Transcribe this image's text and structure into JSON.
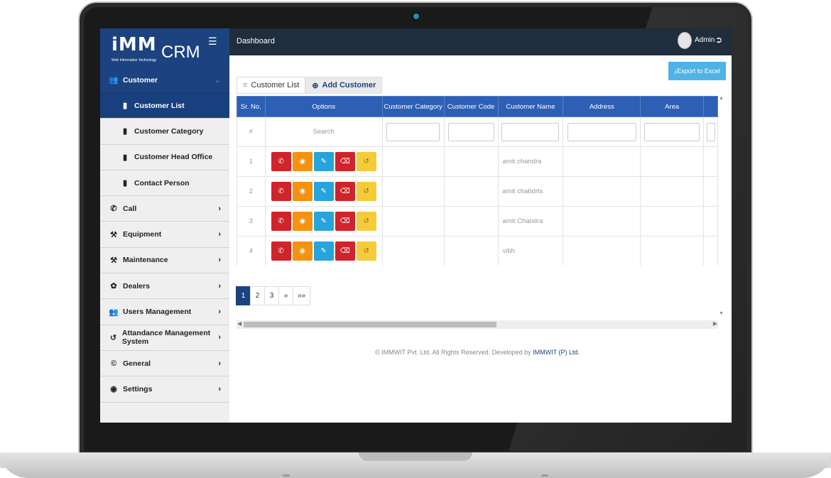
{
  "topbar": {
    "title": "Dashboard",
    "user": "Admin"
  },
  "brand": {
    "logo": "iMM",
    "logo_sub": "Web Information Technology",
    "app": "CRM"
  },
  "sidebar": {
    "items": [
      {
        "label": "Customer",
        "icon": "users-icon"
      },
      {
        "label": "Customer List",
        "icon": "doc-icon"
      },
      {
        "label": "Customer Category",
        "icon": "doc-icon"
      },
      {
        "label": "Customer Head Office",
        "icon": "doc-icon"
      },
      {
        "label": "Contact Person",
        "icon": "doc-icon"
      },
      {
        "label": "Call",
        "icon": "phone-icon"
      },
      {
        "label": "Equipment",
        "icon": "tools-icon"
      },
      {
        "label": "Maintenance",
        "icon": "tools-icon"
      },
      {
        "label": "Dealers",
        "icon": "leaf-icon"
      },
      {
        "label": "Users Management",
        "icon": "users-icon"
      },
      {
        "label": "Attandance Management System",
        "icon": "history-icon"
      },
      {
        "label": "General",
        "icon": "copyright-icon"
      },
      {
        "label": "Settings",
        "icon": "lifebuoy-icon"
      }
    ]
  },
  "actions": {
    "export": "Export to Excel"
  },
  "tabs": {
    "list": "Customer List",
    "add": "Add Customer"
  },
  "table": {
    "headers": [
      "Sr. No.",
      "Options",
      "Customer Category",
      "Customer Code",
      "Customer Name",
      "Address",
      "Area"
    ],
    "filter": {
      "sr": "#",
      "search": "Search"
    },
    "rows": [
      {
        "sr": "1",
        "name": "amit chandra"
      },
      {
        "sr": "2",
        "name": "amit chabdrts"
      },
      {
        "sr": "3",
        "name": "amit Chandra"
      },
      {
        "sr": "4",
        "name": "vibh"
      }
    ]
  },
  "pagination": {
    "pages": [
      "1",
      "2",
      "3",
      "»",
      "»»"
    ],
    "current": "1"
  },
  "footer": {
    "copyright": "© IMMWIT Pvt. Ltd. All Rights Reserved.",
    "developed_by": "Developed by",
    "company": "IMMWIT (P) Ltd."
  },
  "colors": {
    "brand": "#1c4380",
    "topbar": "#1f2d3d",
    "header": "#2c5fb5",
    "call_btn": "#d0232a",
    "view_btn": "#f5920f",
    "edit_btn": "#27a3de",
    "delete_btn": "#d0232a",
    "history_btn": "#f4cc3a",
    "export_btn": "#4fb3e6"
  }
}
